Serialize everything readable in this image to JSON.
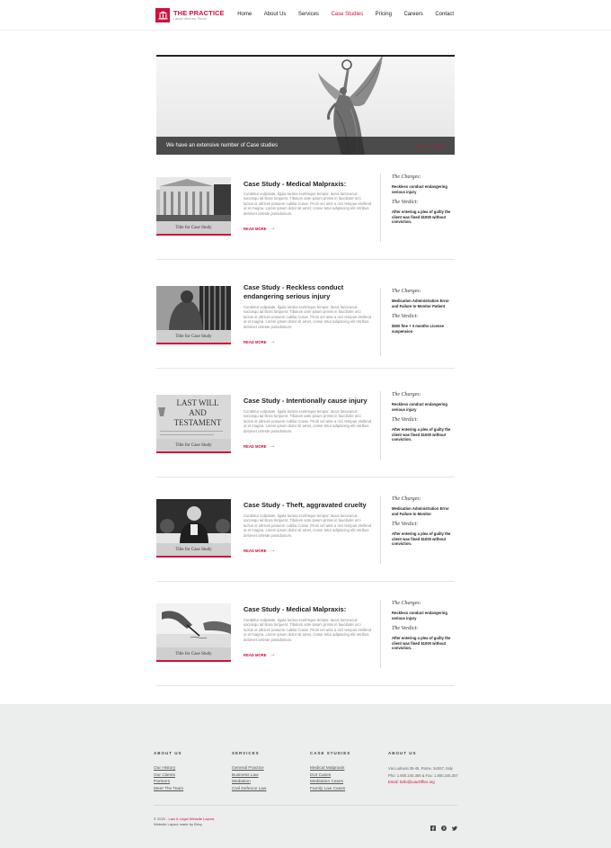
{
  "header": {
    "logo_title": "THE PRACTICE",
    "logo_subtitle": "Lawyer Attorney Theme",
    "nav": [
      "Home",
      "About Us",
      "Services",
      "Case Studies",
      "Pricing",
      "Careers",
      "Contact"
    ],
    "active_nav": "Case Studies"
  },
  "hero": {
    "caption": "We have an extensive number of Case studies",
    "link": "VIEW ALL CASES"
  },
  "cases": [
    {
      "title": "Case Study - Medical Malpraxis:",
      "thumb_caption": "Title for Case Study",
      "body": "Curabitur vulputate, ligula lacinia scelrisque tempor, lacus lacneucus sociosqu ad litora torquent. Tibulum ante ipsum primis in faucibote orci luctus et ultrices posuere cubilia Curae. Proin vel ante a orci tempus eleifend ut et magna. Lorem ipsum dolor sit amet, conse tetur adipiscing elit retribus delorvet celeste possdonium.",
      "read_more": "READ MORE",
      "charges_label": "The Charges:",
      "charges": "Reckless conduct endangering serious injury",
      "verdict_label": "The Verdict:",
      "verdict": "After entering a plea of guilty the client was fined $1000 without conviction."
    },
    {
      "title": "Case Study - Reckless conduct endangering serious injury",
      "thumb_caption": "Title for Case Study",
      "body": "Curabitur vulputate, ligula lacinia scelrisque tempor, lacus lacneucus sociosqu ad litora torquent. Tibulum ante ipsum primis in faucibote orci luctus et ultrices posuere cubilia Curae. Proin vel ante a orci tempus eleifend ut et magna. Lorem ipsum dolor sit amet, conse tetur adipiscing elit retribus delorvet celeste possdonium.",
      "read_more": "READ MORE",
      "charges_label": "The Charges:",
      "charges": "Medication Administration Error and Failure to Monitor Patient",
      "verdict_label": "The Verdict:",
      "verdict": "$500 fine + 3 months License suspension"
    },
    {
      "title": "Case Study - Intentionally cause injury",
      "thumb_caption": "Title for Case Study",
      "body": "Curabitur vulputate, ligula lacinia scelrisque tempor, lacus lacneucus sociosqu ad litora torquent. Tibulum ante ipsum primis in faucibote orci luctus et ultrices posuere cubilia Curae. Proin vel ante a orci tempus eleifend ut et magna. Lorem ipsum dolor sit amet, conse tetur adipiscing elit retribus delorvet celeste possdonium.",
      "read_more": "READ MORE",
      "charges_label": "The Charges:",
      "charges": "Reckless conduct endangering serious injury",
      "verdict_label": "The Verdict:",
      "verdict": "After entering a plea of guilty the client was fined $1000 without conviction."
    },
    {
      "title": "Case Study - Theft, aggravated cruelty",
      "thumb_caption": "Title for Case Study",
      "body": "Curabitur vulputate, ligula lacinia scelrisque tempor, lacus lacneucus sociosqu ad litora torquent. Tibulum ante ipsum primis in faucibote orci luctus et ultrices posuere cubilia Curae. Proin vel ante a orci tempus eleifend ut et magna. Lorem ipsum dolor sit amet, conse tetur adipiscing elit retribus delorvet celeste possdonium.",
      "read_more": "READ MORE",
      "charges_label": "The Charges:",
      "charges": "Medication Administration Error and Failure to Monitor",
      "verdict_label": "The Verdict:",
      "verdict": "After entering a plea of guilty the client was fined $1000 without conviction."
    },
    {
      "title": "Case Study - Medical Malpraxis:",
      "thumb_caption": "Title for Case Study",
      "body": "Curabitur vulputate, ligula lacinia scelrisque tempor, lacus lacneucus sociosqu ad litora torquent. Tibulum ante ipsum primis in faucibote orci luctus et ultrices posuere cubilia Curae. Proin vel ante a orci tempus eleifend ut et magna. Lorem ipsum dolor sit amet, conse tetur adipiscing elit retribus delorvet celeste possdonium.",
      "read_more": "READ MORE",
      "charges_label": "The Charges:",
      "charges": "Reckless conduct endangering serious injury",
      "verdict_label": "The Verdict:",
      "verdict": "After entering a plea of guilty the client was fined $1000 without conviction."
    }
  ],
  "thumb_text": {
    "will_line1": "LAST WILL",
    "will_line2": "AND",
    "will_line3": "TESTAMENT"
  },
  "footer": {
    "about": {
      "heading": "ABOUT US",
      "links": [
        "Our History",
        "Our Clients",
        "Partners",
        "Meet The Team"
      ]
    },
    "services": {
      "heading": "SERVICES",
      "links": [
        "General Practice",
        "Business Law",
        "Mediation",
        "Civil Defence Law"
      ]
    },
    "case_studies": {
      "heading": "CASE STUDIES",
      "links": [
        "Medical Malpraxis",
        "DUI Cases",
        "Meditation Cases",
        "Family Law Cases"
      ]
    },
    "contact": {
      "heading": "ABOUT US",
      "address": "Via Ludovisi 39-45, Rome, 54267, Italy",
      "phone": "Pho: 1.800.245.356 & Fax: 1.800.245.357",
      "email": "Email: hello@LawOffice.org"
    },
    "copyright": "© 2020 -",
    "copyright_link": "Law & Legal Website Layout",
    "made_by": "Website Layout made by Brixy",
    "social_icons": [
      "facebook-icon",
      "pinterest-icon",
      "twitter-icon"
    ]
  },
  "colors": {
    "accent": "#d0103a",
    "footer_bg": "#eceded",
    "hero_bar": "#282828"
  }
}
